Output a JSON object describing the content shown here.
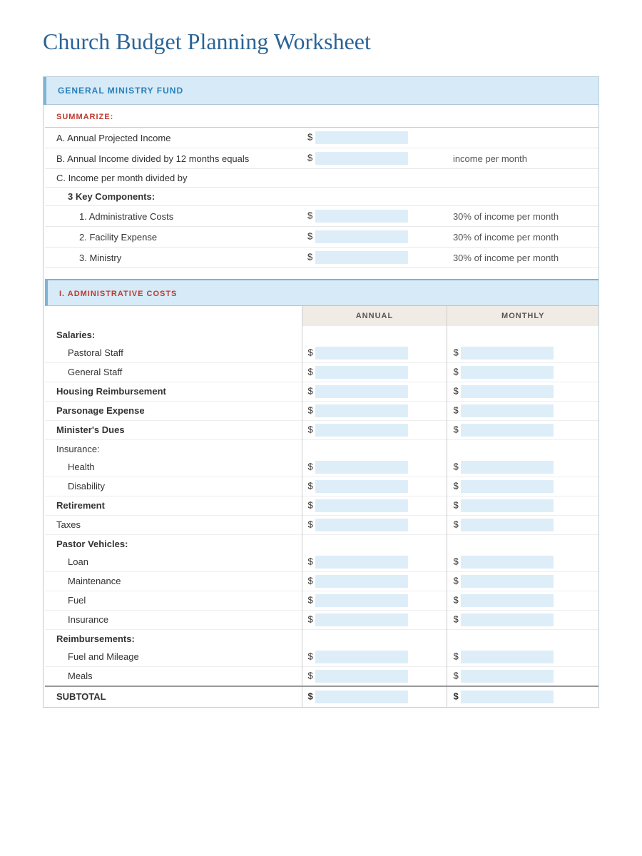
{
  "title": "Church Budget Planning Worksheet",
  "sections": {
    "general_ministry_fund": {
      "header": "GENERAL MINISTRY FUND",
      "summarize_label": "SUMMARIZE:",
      "rows": [
        {
          "label": "A. Annual Projected Income",
          "prefix": "$",
          "note": ""
        },
        {
          "label": "B. Annual Income divided by 12 months equals",
          "prefix": "$",
          "note": "income per month"
        },
        {
          "label": "C. Income per month divided by",
          "prefix": "",
          "note": ""
        }
      ],
      "key_components": {
        "title": "3 Key Components:",
        "items": [
          {
            "label": "1. Administrative Costs",
            "prefix": "$",
            "note": "30% of income per month"
          },
          {
            "label": "2. Facility Expense",
            "prefix": "$",
            "note": "30% of income per month"
          },
          {
            "label": "3. Ministry",
            "prefix": "$",
            "note": "30% of income per month"
          }
        ]
      }
    },
    "administrative_costs": {
      "header": "I. ADMINISTRATIVE COSTS",
      "col_annual": "ANNUAL",
      "col_monthly": "MONTHLY",
      "groups": [
        {
          "group_label": "Salaries:",
          "bold": true,
          "items": [
            {
              "label": "Pastoral Staff",
              "indent": 2,
              "has_annual": true,
              "has_monthly": true
            },
            {
              "label": "General Staff",
              "indent": 2,
              "has_annual": true,
              "has_monthly": true
            }
          ]
        },
        {
          "group_label": "Housing Reimbursement",
          "bold": true,
          "items": [],
          "has_annual": true,
          "has_monthly": true
        },
        {
          "group_label": "Parsonage Expense",
          "bold": true,
          "items": [],
          "has_annual": true,
          "has_monthly": true
        },
        {
          "group_label": "Minister's Dues",
          "bold": true,
          "items": [],
          "has_annual": true,
          "has_monthly": true
        },
        {
          "group_label": "Insurance:",
          "bold": false,
          "items": [
            {
              "label": "Health",
              "indent": 2,
              "has_annual": true,
              "has_monthly": true
            },
            {
              "label": "Disability",
              "indent": 2,
              "has_annual": true,
              "has_monthly": true
            }
          ]
        },
        {
          "group_label": "Retirement",
          "bold": true,
          "items": [],
          "has_annual": true,
          "has_monthly": true
        },
        {
          "group_label": "Taxes",
          "bold": false,
          "items": [],
          "has_annual": true,
          "has_monthly": true
        },
        {
          "group_label": "Pastor Vehicles:",
          "bold": true,
          "items": [
            {
              "label": "Loan",
              "indent": 2,
              "has_annual": true,
              "has_monthly": true
            },
            {
              "label": "Maintenance",
              "indent": 2,
              "has_annual": true,
              "has_monthly": true
            },
            {
              "label": "Fuel",
              "indent": 2,
              "has_annual": true,
              "has_monthly": true
            },
            {
              "label": "Insurance",
              "indent": 2,
              "has_annual": true,
              "has_monthly": true
            }
          ]
        },
        {
          "group_label": "Reimbursements:",
          "bold": true,
          "items": [
            {
              "label": "Fuel and Mileage",
              "indent": 2,
              "has_annual": true,
              "has_monthly": true
            },
            {
              "label": "Meals",
              "indent": 2,
              "has_annual": true,
              "has_monthly": true
            }
          ]
        }
      ],
      "subtotal_label": "SUBTOTAL",
      "dollar_sign": "$"
    }
  }
}
